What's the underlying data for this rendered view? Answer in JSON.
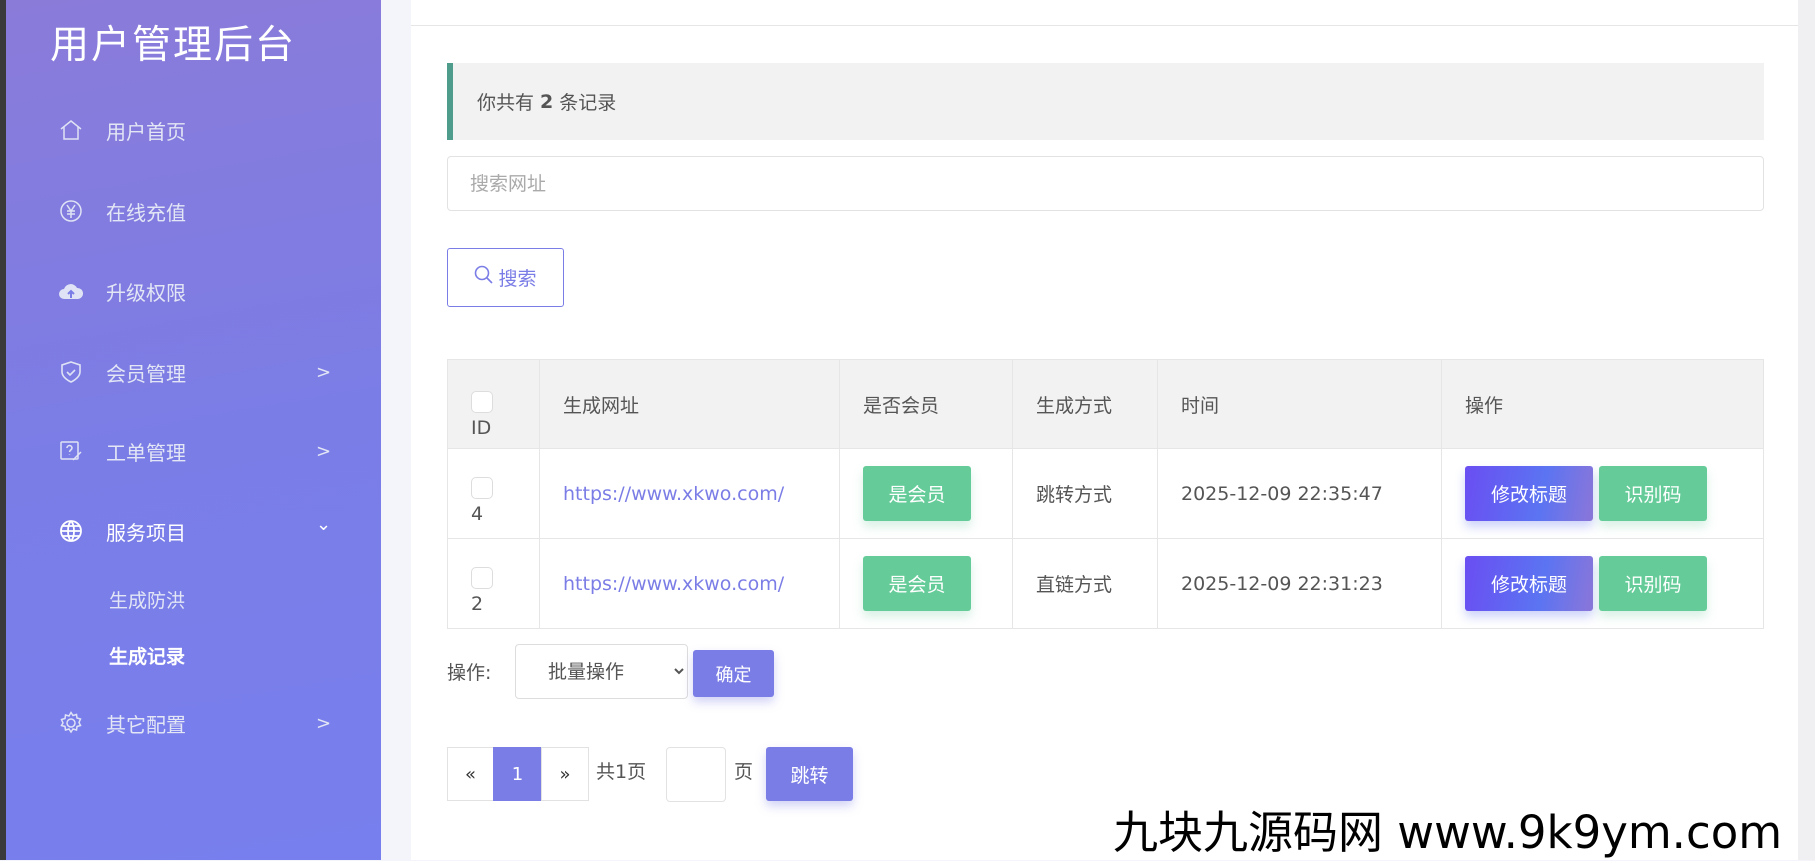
{
  "sidebar": {
    "title": "用户管理后台",
    "items": [
      {
        "label": "用户首页",
        "icon": "home-icon"
      },
      {
        "label": "在线充值",
        "icon": "yen-icon"
      },
      {
        "label": "升级权限",
        "icon": "cloud-upload-icon"
      },
      {
        "label": "会员管理",
        "icon": "shield-icon",
        "chevron": ">"
      },
      {
        "label": "工单管理",
        "icon": "ticket-icon",
        "chevron": ">"
      },
      {
        "label": "服务项目",
        "icon": "globe-icon",
        "chevron": "⌄"
      },
      {
        "label": "其它配置",
        "icon": "gear-icon",
        "chevron": ">"
      }
    ],
    "subitems": [
      {
        "label": "生成防洪"
      },
      {
        "label": "生成记录"
      }
    ]
  },
  "notice": {
    "prefix": "你共有",
    "count": "2",
    "suffix": "条记录"
  },
  "search": {
    "placeholder": "搜索网址",
    "button": "搜索"
  },
  "table": {
    "headers": [
      "ID",
      "生成网址",
      "是否会员",
      "生成方式",
      "时间",
      "操作"
    ],
    "rows": [
      {
        "id": "4",
        "url": "https://www.xkwo.com/",
        "member": "是会员",
        "method": "跳转方式",
        "time": "2025-12-09 22:35:47",
        "edit": "修改标题",
        "qr": "识别码"
      },
      {
        "id": "2",
        "url": "https://www.xkwo.com/",
        "member": "是会员",
        "method": "直链方式",
        "time": "2025-12-09 22:31:23",
        "edit": "修改标题",
        "qr": "识别码"
      }
    ]
  },
  "bulk": {
    "label": "操作:",
    "selected": "批量操作",
    "confirm": "确定"
  },
  "pagination": {
    "prev": "«",
    "current": "1",
    "next": "»",
    "total": "共1页",
    "page_unit": "页",
    "jump": "跳转"
  },
  "watermark": "九块九源码网 www.9k9ym.com"
}
